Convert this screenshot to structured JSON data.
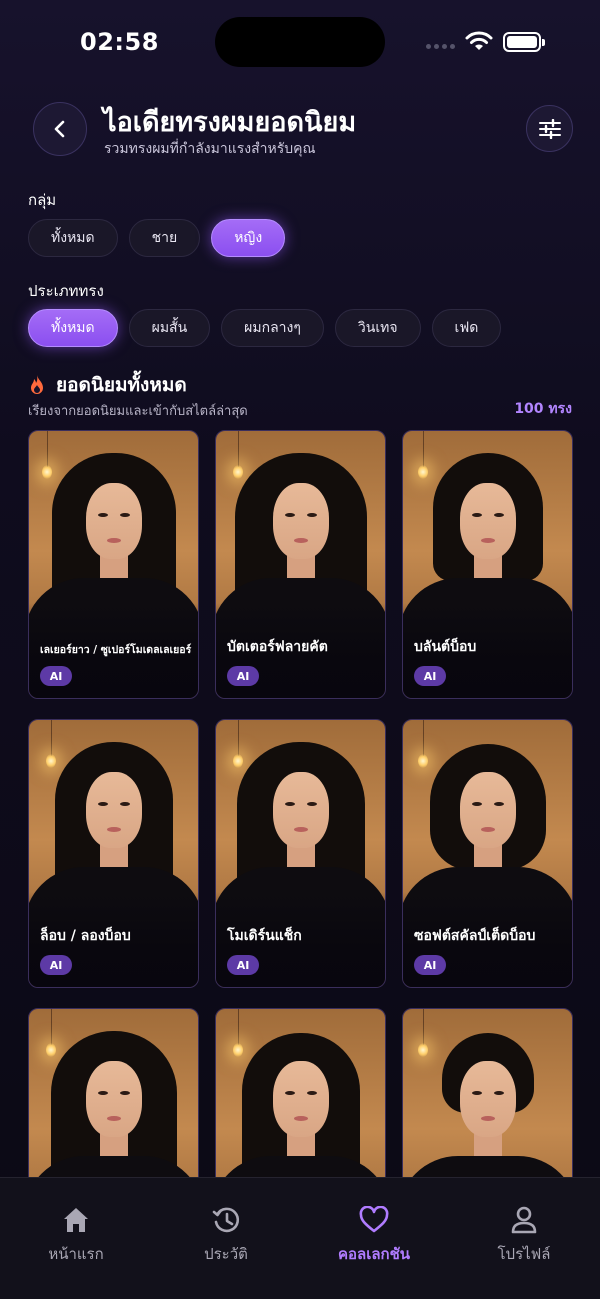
{
  "status_bar": {
    "time": "02:58"
  },
  "header": {
    "title": "ไอเดียทรงผมยอดนิยม",
    "subtitle": "รวมทรงผมที่กำลังมาแรงสำหรับคุณ"
  },
  "group": {
    "label": "กลุ่ม",
    "chips": [
      {
        "label": "ทั้งหมด",
        "active": false
      },
      {
        "label": "ชาย",
        "active": false
      },
      {
        "label": "หญิง",
        "active": true
      }
    ]
  },
  "style_type": {
    "label": "ประเภททรง",
    "chips": [
      {
        "label": "ทั้งหมด",
        "active": true
      },
      {
        "label": "ผมสั้น",
        "active": false
      },
      {
        "label": "ผมกลางๆ",
        "active": false
      },
      {
        "label": "วินเทจ",
        "active": false
      },
      {
        "label": "เฟด",
        "active": false
      }
    ]
  },
  "popular": {
    "title": "ยอดนิยมทั้งหมด",
    "subtitle": "เรียงจากยอดนิยมและเข้ากับสไตล์ล่าสุด",
    "count": "100 ทรง"
  },
  "cards": [
    {
      "name": "เลเยอร์ยาว / ซูเปอร์โมเดลเลเยอร์",
      "badge": "AI"
    },
    {
      "name": "บัตเตอร์ฟลายคัต",
      "badge": "AI"
    },
    {
      "name": "บลันต์บ็อบ",
      "badge": "AI"
    },
    {
      "name": "ล็อบ / ลองบ็อบ",
      "badge": "AI"
    },
    {
      "name": "โมเดิร์นแช็ก",
      "badge": "AI"
    },
    {
      "name": "ซอฟต์สคัลป์เต็ดบ็อบ",
      "badge": "AI"
    },
    {
      "name": "",
      "badge": ""
    },
    {
      "name": "",
      "badge": ""
    },
    {
      "name": "",
      "badge": ""
    }
  ],
  "bottom_nav": [
    {
      "label": "หน้าแรก",
      "icon": "home-icon",
      "active": false
    },
    {
      "label": "ประวัติ",
      "icon": "history-icon",
      "active": false
    },
    {
      "label": "คอลเลกชัน",
      "icon": "heart-icon",
      "active": true
    },
    {
      "label": "โปรไฟล์",
      "icon": "profile-icon",
      "active": false
    }
  ],
  "colors": {
    "accent": "#9b5cf6",
    "accent_text": "#b07cff",
    "background": "#0f0c1e"
  }
}
